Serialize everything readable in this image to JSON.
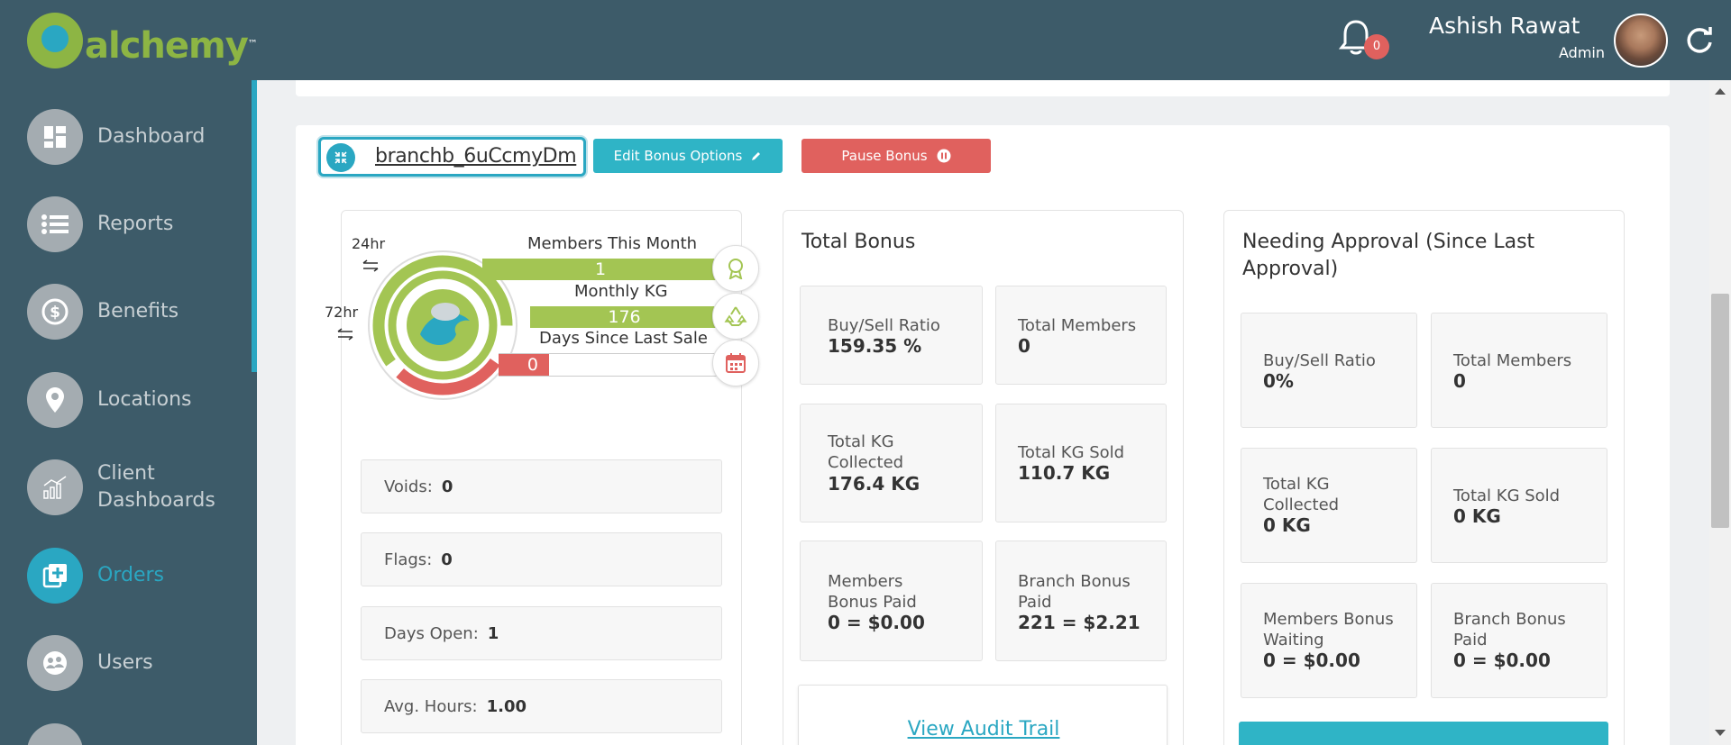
{
  "app": {
    "logo_text": "alchemy",
    "logo_tm": "™"
  },
  "header": {
    "notification_count": "0",
    "user_name": "Ashish Rawat",
    "user_role": "Admin"
  },
  "sidebar": {
    "items": [
      {
        "label": "Dashboard",
        "icon": "dashboard-icon"
      },
      {
        "label": "Reports",
        "icon": "list-icon"
      },
      {
        "label": "Benefits",
        "icon": "dollar-icon"
      },
      {
        "label": "Locations",
        "icon": "map-pin-icon"
      },
      {
        "label": "Client Dashboards",
        "icon": "chart-icon"
      },
      {
        "label": "Orders",
        "icon": "add-box-icon",
        "active": true
      },
      {
        "label": "Users",
        "icon": "users-icon"
      }
    ],
    "accent_color": "#2aa7c2"
  },
  "branch": {
    "name": "branchb_6uCcmyDm",
    "edit_button": "Edit Bonus Options",
    "pause_button": "Pause Bonus"
  },
  "widget": {
    "label_24hr": "24hr",
    "label_72hr": "72hr",
    "members_label": "Members This Month",
    "members_value": "1",
    "kg_label": "Monthly KG",
    "kg_value": "176",
    "days_label": "Days Since Last Sale",
    "days_value": "0",
    "colors": {
      "green": "#a3c553",
      "red": "#e0615e",
      "teal": "#2aa7c2"
    }
  },
  "info_rows": [
    {
      "label": "Voids:",
      "value": "0"
    },
    {
      "label": "Flags:",
      "value": "0"
    },
    {
      "label": "Days Open:",
      "value": "1"
    },
    {
      "label": "Avg. Hours:",
      "value": "1.00"
    }
  ],
  "total_bonus": {
    "title": "Total Bonus",
    "stats": [
      {
        "label": "Buy/Sell Ratio",
        "value": "159.35 %"
      },
      {
        "label": "Total Members",
        "value": "0"
      },
      {
        "label": "Total KG Collected",
        "value": "176.4 KG"
      },
      {
        "label": "Total KG Sold",
        "value": "110.7 KG"
      },
      {
        "label": "Members Bonus Paid",
        "value": "0 = $0.00"
      },
      {
        "label": "Branch Bonus Paid",
        "value": "221 = $2.21"
      }
    ],
    "audit_link": "View Audit Trail"
  },
  "needing_approval": {
    "title": "Needing Approval (Since Last Approval)",
    "stats": [
      {
        "label": "Buy/Sell Ratio",
        "value": "0%"
      },
      {
        "label": "Total Members",
        "value": "0"
      },
      {
        "label": "Total KG Collected",
        "value": "0 KG"
      },
      {
        "label": "Total KG Sold",
        "value": "0 KG"
      },
      {
        "label": "Members Bonus Waiting",
        "value": "0 = $0.00"
      },
      {
        "label": "Branch Bonus Paid",
        "value": "0 = $0.00"
      }
    ]
  }
}
